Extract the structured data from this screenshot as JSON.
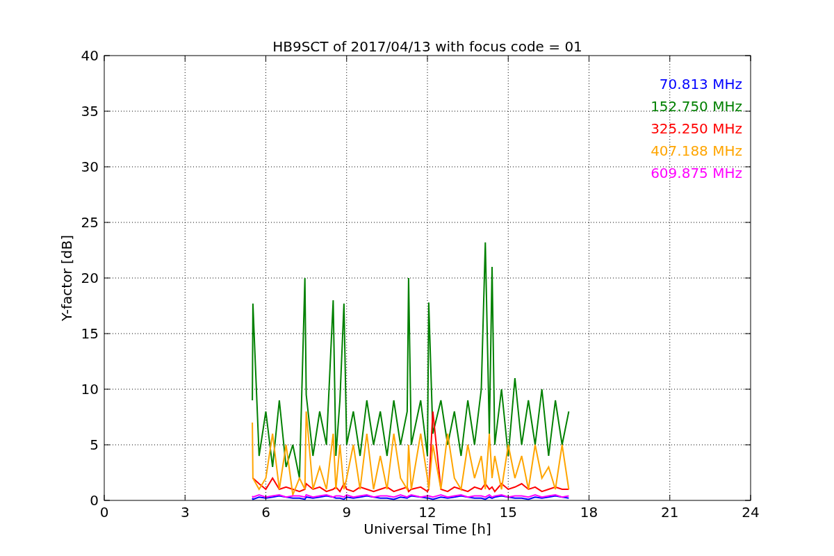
{
  "chart_data": {
    "type": "line",
    "grid": true,
    "title": "HB9SCT of 2017/04/13 with focus code = 01",
    "xlabel": "Universal Time [h]",
    "ylabel": "Y-factor [dB]",
    "xlim": [
      0,
      24
    ],
    "ylim": [
      0,
      40
    ],
    "xticks": [
      0,
      3,
      6,
      9,
      12,
      15,
      18,
      21,
      24
    ],
    "yticks": [
      0,
      5,
      10,
      15,
      20,
      25,
      30,
      35,
      40
    ],
    "x": [
      5.5,
      5.52,
      5.75,
      6.0,
      6.25,
      6.5,
      6.75,
      7.0,
      7.25,
      7.45,
      7.5,
      7.75,
      8.0,
      8.25,
      8.5,
      8.6,
      8.75,
      8.9,
      9.0,
      9.25,
      9.5,
      9.75,
      10.0,
      10.25,
      10.5,
      10.75,
      11.0,
      11.25,
      11.3,
      11.4,
      11.75,
      12.0,
      12.05,
      12.2,
      12.5,
      12.75,
      13.0,
      13.25,
      13.5,
      13.75,
      14.0,
      14.15,
      14.3,
      14.4,
      14.5,
      14.75,
      15.0,
      15.25,
      15.5,
      15.75,
      16.0,
      16.25,
      16.5,
      16.75,
      17.0,
      17.25
    ],
    "series": [
      {
        "name": "70.813 MHz",
        "color": "#0000ff",
        "values": [
          0.2,
          0.1,
          0.3,
          0.2,
          0.3,
          0.4,
          0.3,
          0.2,
          0.2,
          0.1,
          0.3,
          0.2,
          0.3,
          0.4,
          0.3,
          0.2,
          0.2,
          0.1,
          0.3,
          0.2,
          0.3,
          0.4,
          0.3,
          0.2,
          0.2,
          0.1,
          0.3,
          0.2,
          0.3,
          0.4,
          0.3,
          0.2,
          0.2,
          0.1,
          0.3,
          0.2,
          0.3,
          0.4,
          0.3,
          0.2,
          0.2,
          0.1,
          0.3,
          0.2,
          0.3,
          0.4,
          0.3,
          0.2,
          0.2,
          0.1,
          0.3,
          0.2,
          0.3,
          0.4,
          0.3,
          0.2
        ]
      },
      {
        "name": "152.750 MHz",
        "color": "#008000",
        "values": [
          9,
          17.7,
          4,
          8,
          3,
          9,
          3,
          5,
          2,
          20,
          9.5,
          4,
          8,
          5,
          18,
          4,
          9,
          17.7,
          5,
          8,
          4,
          9,
          5,
          8,
          4,
          9,
          5,
          8,
          20,
          5,
          9,
          4,
          17.8,
          6,
          9,
          5,
          8,
          4,
          9,
          5,
          10,
          23.2,
          6,
          21,
          5,
          10,
          4,
          11,
          5,
          9,
          5,
          10,
          4,
          9,
          5,
          8
        ]
      },
      {
        "name": "325.250 MHz",
        "color": "#ff0000",
        "values": [
          2,
          2,
          1.5,
          1,
          2,
          1,
          1.2,
          1,
          0.8,
          1,
          1.5,
          1,
          1.2,
          0.8,
          1,
          1.2,
          0.8,
          1.5,
          1,
          0.8,
          1.2,
          1,
          0.8,
          1,
          1.2,
          0.8,
          1,
          1.2,
          0.8,
          1,
          1.2,
          0.8,
          1,
          8,
          1,
          0.8,
          1.2,
          1,
          0.8,
          1.2,
          1,
          1.5,
          1,
          1.2,
          0.8,
          1.5,
          1,
          1.2,
          1.5,
          1,
          1.2,
          0.8,
          1,
          1.2,
          1,
          1
        ]
      },
      {
        "name": "407.188 MHz",
        "color": "#ffa500",
        "values": [
          7,
          2,
          1,
          2,
          6,
          1,
          5,
          0.5,
          2,
          1,
          8,
          1,
          3,
          1,
          6,
          1,
          5,
          1,
          2,
          5,
          1,
          6,
          1,
          4,
          1,
          6,
          2,
          1,
          5,
          1,
          6,
          2,
          1,
          5,
          1,
          6,
          2,
          1,
          5,
          2,
          4,
          1,
          6,
          2,
          4,
          1,
          5,
          2,
          4,
          1,
          5,
          2,
          3,
          1,
          5,
          1
        ]
      },
      {
        "name": "609.875 MHz",
        "color": "#ff00ff",
        "values": [
          0.4,
          0.3,
          0.5,
          0.3,
          0.4,
          0.5,
          0.3,
          0.4,
          0.4,
          0.3,
          0.5,
          0.3,
          0.4,
          0.5,
          0.3,
          0.4,
          0.4,
          0.3,
          0.5,
          0.3,
          0.4,
          0.5,
          0.3,
          0.4,
          0.4,
          0.3,
          0.5,
          0.3,
          0.4,
          0.5,
          0.3,
          0.4,
          0.4,
          0.3,
          0.5,
          0.3,
          0.4,
          0.5,
          0.3,
          0.4,
          0.4,
          0.3,
          0.5,
          0.3,
          0.4,
          0.5,
          0.3,
          0.4,
          0.4,
          0.3,
          0.5,
          0.3,
          0.4,
          0.5,
          0.3,
          0.4
        ]
      }
    ]
  }
}
